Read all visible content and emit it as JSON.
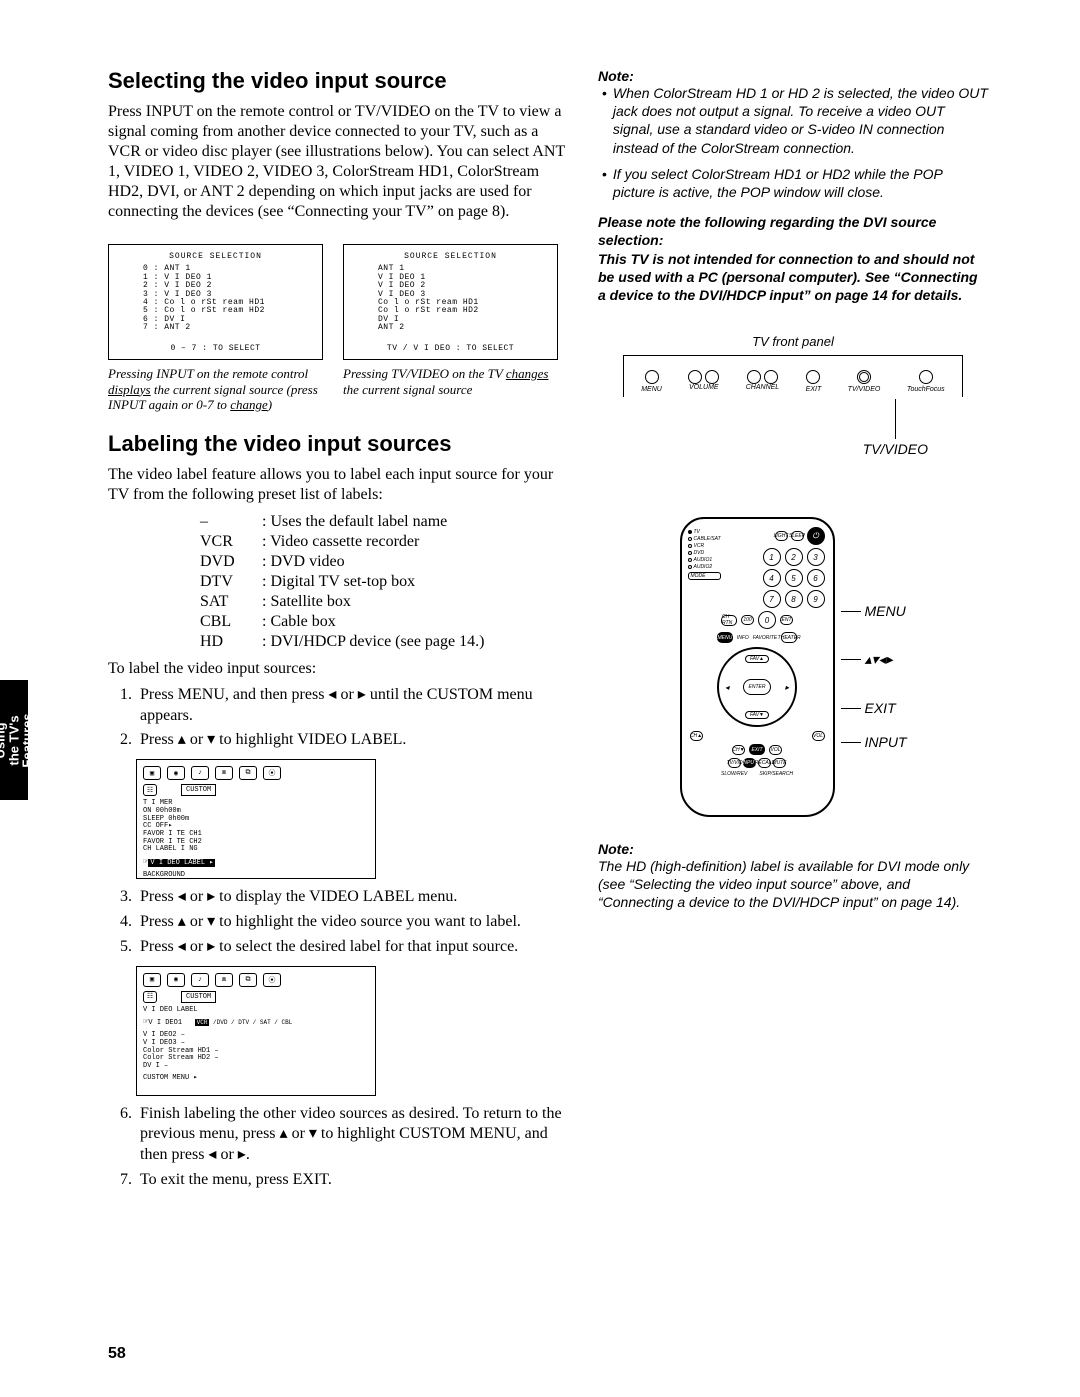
{
  "page_number": "58",
  "side_tab": "Using the TV's\nFeatures",
  "section1": {
    "heading": "Selecting the video input source",
    "body": "Press INPUT on the remote control or TV/VIDEO on the TV to view a signal coming from another device connected to your TV, such as a VCR or video disc player (see illustrations below). You can select ANT 1, VIDEO 1, VIDEO 2, VIDEO 3, ColorStream HD1, ColorStream HD2, DVI, or ANT 2 depending on which input jacks are used for connecting the devices (see “Connecting your TV” on page 8)."
  },
  "osd1": {
    "title": "SOURCE  SELECTION",
    "items": [
      "0 : ANT  1",
      "1 : V I DEO  1",
      "2 : V I DEO  2",
      "3 : V I DEO  3",
      "4 : Co l o rSt ream  HD1",
      "5 : Co l o rSt ream  HD2",
      "6 : DV I",
      "7 : ANT  2"
    ],
    "footer": "0 – 7 : TO  SELECT",
    "caption_pre": "Pressing INPUT on the remote control ",
    "caption_u1": "displays",
    "caption_mid": " the current signal source (press INPUT again or 0-7 to ",
    "caption_u2": "change",
    "caption_post": ")"
  },
  "osd2": {
    "title": "SOURCE  SELECTION",
    "items": [
      "ANT  1",
      "V I DEO  1",
      "V I DEO  2",
      "V I DEO  3",
      "Co l o rSt ream  HD1",
      "Co l o rSt ream  HD2",
      "DV I",
      "ANT  2"
    ],
    "footer": "TV / V I DEO : TO  SELECT",
    "caption_pre": "Pressing TV/VIDEO on the TV ",
    "caption_u1": "changes",
    "caption_post": " the current signal source"
  },
  "notes1": {
    "title": "Note:",
    "b1": "When ColorStream HD 1 or HD 2 is selected, the video OUT jack does not output a signal. To receive a video OUT signal, use a standard video or S-video IN connection instead of the ColorStream connection.",
    "b2": "If you select ColorStream HD1 or HD2 while the POP picture is active, the POP window will close.",
    "please_title": "Please note the following regarding the DVI source selection:",
    "please_body": "This TV is not intended for connection to and should not be used with a PC (personal computer). See “Connecting a device to the DVI/HDCP input” on page 14 for details."
  },
  "section2": {
    "heading": "Labeling the video input sources",
    "lead": "The video label feature allows you to label each input source for your TV from the following preset list of labels:",
    "rows": [
      {
        "k": "–",
        "v": "Uses the default label name"
      },
      {
        "k": "VCR",
        "v": "Video cassette recorder"
      },
      {
        "k": "DVD",
        "v": "DVD video"
      },
      {
        "k": "DTV",
        "v": "Digital TV set-top box"
      },
      {
        "k": "SAT",
        "v": "Satellite box"
      },
      {
        "k": "CBL",
        "v": "Cable box"
      },
      {
        "k": "HD",
        "v": "DVI/HDCP device (see page 14.)"
      }
    ],
    "intro2": "To label the video input sources:",
    "steps": [
      "Press MENU, and then press ◂ or ▸ until the CUSTOM menu appears.",
      "Press ▴ or ▾ to highlight VIDEO LABEL.",
      "Press ◂ or ▸ to display the VIDEO LABEL menu.",
      "Press ▴ or ▾ to highlight the video source you want to label.",
      "Press ◂ or ▸ to select the desired label for that input source.",
      "Finish labeling the other video sources as desired. To return to the previous menu, press ▴ or ▾ to highlight CUSTOM MENU, and then press ◂ or ▸.",
      "To exit the menu, press EXIT."
    ]
  },
  "custom_box1": {
    "label": "CUSTOM",
    "lines": [
      "T I MER",
      "   ON              00h00m",
      "   SLEEP            0h00m",
      "CC                 OFF▸",
      "FAVOR I TE  CH1",
      "FAVOR I TE  CH2",
      "CH  LABEL I NG"
    ],
    "hl": "V I DEO  LABEL            ▸",
    "post": "BACKGROUND"
  },
  "custom_box2": {
    "label": "CUSTOM",
    "head": "V I DEO       LABEL",
    "row1_l": "V I DEO1",
    "row1_r": "◂VCR /DVD / DTV / SAT / CBL",
    "lines": [
      " V I DEO2           –",
      " V I DEO3           –",
      "Color Stream  HD1   –",
      "Color Stream  HD2   –",
      "DV I                –"
    ],
    "foot": "CUSTOM  MENU        ▸"
  },
  "right_panel": {
    "title": "TV front panel",
    "buttons": [
      "MENU",
      "VOLUME",
      "CHANNEL",
      "EXIT",
      "TV/VIDEO",
      "TouchFocus"
    ],
    "callout": "TV/VIDEO"
  },
  "remote_callouts": [
    "MENU",
    "▴▾◂▸",
    "EXIT",
    "INPUT"
  ],
  "notes2": {
    "title": "Note:",
    "body": "The HD (high-definition) label is available for DVI mode only (see “Selecting the video input source” above, and “Connecting a device to the DVI/HDCP input” on page 14)."
  }
}
